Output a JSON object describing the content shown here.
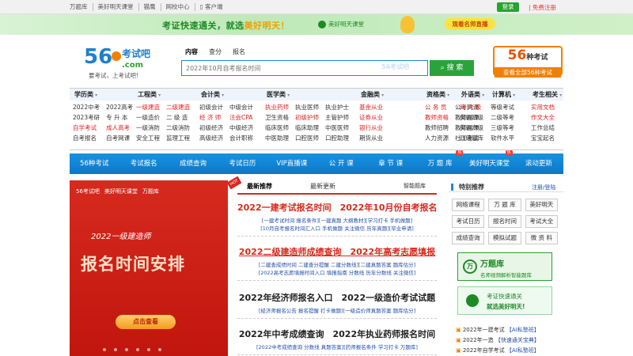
{
  "topbar": {
    "links": [
      "万题库",
      "美好明天课堂",
      "猫鹰",
      "网校中心",
      "客户端"
    ],
    "login": "登录",
    "register": "| 免费注册"
  },
  "banner": {
    "text_a": "考证快速通关，就选",
    "text_hl": "美好明天！",
    "brand": "美好明天课堂",
    "button": "观看名师直播"
  },
  "header": {
    "logo_num": "56",
    "logo_text": "考试吧",
    "logo_dom": ".com",
    "slogan": "要考试，上考试吧!",
    "search_tabs": [
      "内容",
      "查分",
      "报名"
    ],
    "search_placeholder": "2022年10月自考报名时间",
    "search_watermark": "56考试吧",
    "search_button": "搜 索",
    "promo_big": "56",
    "promo_unit": "种考试",
    "promo_sub": "查看全部56种考试"
  },
  "categories": [
    {
      "head": "学历类",
      "items": [
        [
          "2022中考",
          ""
        ],
        [
          "2022高考",
          ""
        ],
        [
          "2023考研",
          ""
        ],
        [
          "专 升 本",
          ""
        ],
        [
          "自学考试",
          "red"
        ],
        [
          "成人高考",
          "red"
        ],
        [
          "自考报名",
          ""
        ],
        [
          "自考网课",
          ""
        ]
      ]
    },
    {
      "head": "工程类",
      "items": [
        [
          "一级建造",
          "red"
        ],
        [
          "二级建造",
          "red"
        ],
        [
          "一级造价",
          ""
        ],
        [
          "二 级 造",
          ""
        ],
        [
          "一级消防",
          ""
        ],
        [
          "二级消防",
          ""
        ],
        [
          "安全工程",
          ""
        ],
        [
          "监理工程",
          ""
        ]
      ]
    },
    {
      "head": "会计类",
      "items": [
        [
          "初级会计",
          ""
        ],
        [
          "中级会计",
          ""
        ],
        [
          "经 济 师",
          "red"
        ],
        [
          "注会CPA",
          "red"
        ],
        [
          "初级经济",
          ""
        ],
        [
          "中级经济",
          ""
        ],
        [
          "高级经济",
          ""
        ],
        [
          "会计职称",
          ""
        ]
      ]
    },
    {
      "head": "医学类",
      "items": [
        [
          "执业药师",
          "red"
        ],
        [
          "执业医师",
          ""
        ],
        [
          "执业护士",
          ""
        ],
        [
          "卫生资格",
          ""
        ],
        [
          "初级护师",
          "red"
        ],
        [
          "主管护师",
          ""
        ],
        [
          "临床医师",
          ""
        ],
        [
          "临床助理",
          ""
        ],
        [
          "中医医师",
          ""
        ],
        [
          "中医助理",
          ""
        ],
        [
          "口腔医师",
          ""
        ],
        [
          "口腔助理",
          ""
        ]
      ]
    },
    {
      "head": "金融类",
      "items": [
        [
          "基金从业",
          "red"
        ],
        [
          "证券从业",
          "red"
        ],
        [
          "银行从业",
          "red"
        ],
        [
          "期货从业",
          ""
        ]
      ]
    },
    {
      "head": "资格类",
      "items": [
        [
          "公 务 员",
          "red"
        ],
        [
          "公考网课",
          ""
        ],
        [
          "教师资格",
          "red"
        ],
        [
          "教师网课",
          ""
        ],
        [
          "教师招聘",
          ""
        ],
        [
          "教师网课",
          ""
        ],
        [
          "人力资源",
          ""
        ],
        [
          "社工考试",
          ""
        ]
      ]
    },
    {
      "head": "外语类",
      "items": [
        [
          "四 六 级",
          "red"
        ],
        [
          "英语四级",
          ""
        ],
        [
          "英语六级",
          ""
        ],
        [
          "四级题库",
          ""
        ]
      ]
    },
    {
      "head": "计算机",
      "items": [
        [
          "等级考试",
          ""
        ],
        [
          "二级等考",
          ""
        ],
        [
          "三级等考",
          ""
        ],
        [
          "软件水平",
          ""
        ]
      ]
    },
    {
      "head": "考生相关",
      "items": [
        [
          "实用文档",
          "red"
        ],
        [
          "作文大全",
          "red"
        ],
        [
          "工作总结",
          ""
        ],
        [
          "宝宝起名",
          ""
        ]
      ]
    }
  ],
  "nav": [
    {
      "label": "56种考试",
      "hot": ""
    },
    {
      "label": "考试报名",
      "hot": ""
    },
    {
      "label": "成绩查询",
      "hot": ""
    },
    {
      "label": "考试日历",
      "hot": ""
    },
    {
      "label": "VIP直播课",
      "hot": ""
    },
    {
      "label": "公 开 课",
      "hot": ""
    },
    {
      "label": "章 节 课",
      "hot": ""
    },
    {
      "label": "万 题 库",
      "hot": "热"
    },
    {
      "label": "美好明天课堂",
      "hot": "热"
    },
    {
      "label": "滚动更新",
      "hot": ""
    }
  ],
  "slider": {
    "brand_a": "56考试吧",
    "brand_b": "美好明天课堂",
    "brand_c": "万题库",
    "subtitle": "2022一级建造师",
    "title": "报名时间安排",
    "button": "点击查看"
  },
  "news": {
    "hot_badge": "HOT",
    "tabs": [
      "最新推荐",
      "最新更新",
      "智能题库"
    ],
    "blocks": [
      {
        "h": "2022一建考试报名时间　2022年10月份自考报名",
        "style": "red",
        "s": [
          "[一建考试时间 报名条件][一建真题 大纲教材][学习打卡 手机做题]",
          "[10月自考报名时间汇入口 手机做题 关注微信 历年真题][毕业申请]"
        ]
      },
      {
        "h": "2022二级建造师成绩查询　2022年高考志愿填报",
        "style": "red und",
        "s": [
          "[二建查成绩时间 二建查分提醒 二建分数线][二建真题答案 题库估分]",
          "[2022高考志愿填报时间入口 填报指南 分数线 历年分数线 关注微信]"
        ]
      },
      {
        "h": "2022年经济师报名入口　2022一级造价考试试题",
        "style": "dark",
        "s": [
          "[经济师报名公告 报名提醒 打卡做题][一级造价师真题答案 题库估分]"
        ]
      },
      {
        "h": "2022年中考成绩查询　2022年执业药师报名时间",
        "style": "dark",
        "s": [
          "[2022中考成绩查询 分数线 真题答案][药师报名条件 学习打卡 万题库]"
        ]
      }
    ]
  },
  "sidebar": {
    "title": "特别推荐",
    "login": "注册/登陆",
    "grid": [
      "网络课程",
      "万 题 库",
      "美好明天",
      "考试日历",
      "报名时间",
      "考试大全",
      "成绩查询",
      "模拟试题",
      "微 资 料"
    ],
    "ad1_title": "万题库",
    "ad1_sub": "名师视频解析智能题库",
    "ad2_line1": "考证快速通关",
    "ad2_line2": "就选美好明天!",
    "news": [
      {
        "a": "2022年一建考试",
        "b": "【AI私塾班】"
      },
      {
        "a": "2022年一造",
        "b": "【快速通关宝典】"
      },
      {
        "a": "2022年自学考试",
        "b": "【AI私塾班】"
      }
    ]
  },
  "colors": {
    "accent_green": "#27a32f",
    "nav_blue": "#1583d6",
    "accent_red": "#d62a1f",
    "promo_orange": "#f08000"
  }
}
